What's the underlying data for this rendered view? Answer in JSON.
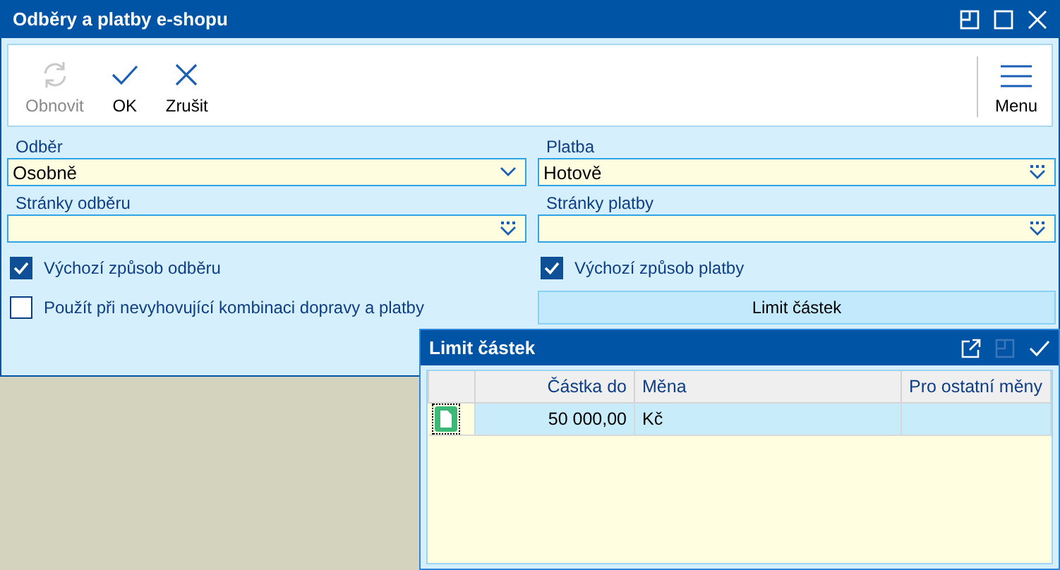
{
  "window": {
    "title": "Odběry a platby e-shopu"
  },
  "toolbar": {
    "buttons": [
      {
        "label": "Obnovit",
        "kind": "refresh",
        "disabled": true
      },
      {
        "label": "OK",
        "kind": "ok",
        "disabled": false
      },
      {
        "label": "Zrušit",
        "kind": "cancel",
        "disabled": false
      }
    ],
    "menu": {
      "label": "Menu"
    }
  },
  "fields": [
    {
      "label": "Odběr",
      "value": "Osobně",
      "kind": "combo"
    },
    {
      "label": "Platba",
      "value": "Hotově",
      "kind": "lookup"
    },
    {
      "label": "Stránky odběru",
      "kind": "lookup"
    },
    {
      "label": "Stránky platby",
      "kind": "lookup"
    }
  ],
  "checkboxes": [
    {
      "label": "Výchozí způsob odběru",
      "checked": true
    },
    {
      "label": "Výchozí způsob platby",
      "checked": true
    },
    {
      "label": "Použít při nevyhovující kombinaci dopravy a platby",
      "checked": false
    }
  ],
  "limit_button": {
    "label": "Limit částek"
  },
  "dialog": {
    "title": "Limit částek",
    "table": {
      "columns": [
        "Částka do",
        "Měna",
        "Pro ostatní měny"
      ],
      "rows": [
        {
          "amount": "50 000,00",
          "currency": "Kč",
          "selected": true
        }
      ]
    }
  }
}
